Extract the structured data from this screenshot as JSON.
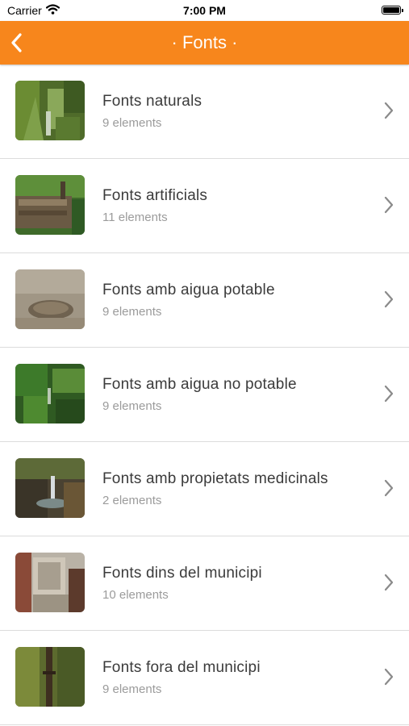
{
  "status_bar": {
    "carrier": "Carrier",
    "time": "7:00 PM"
  },
  "nav": {
    "title": "· Fonts ·",
    "accent_color": "#f7861c",
    "back_icon": "chevron-left-icon"
  },
  "items": [
    {
      "title": "Fonts naturals",
      "count": "9 elements"
    },
    {
      "title": "Fonts artificials",
      "count": "11 elements"
    },
    {
      "title": "Fonts amb aigua potable",
      "count": "9 elements"
    },
    {
      "title": "Fonts amb aigua no potable",
      "count": "9 elements"
    },
    {
      "title": "Fonts amb propietats medicinals",
      "count": "2 elements"
    },
    {
      "title": "Fonts dins del municipi",
      "count": "10 elements"
    },
    {
      "title": "Fonts fora del municipi",
      "count": "9 elements"
    }
  ]
}
